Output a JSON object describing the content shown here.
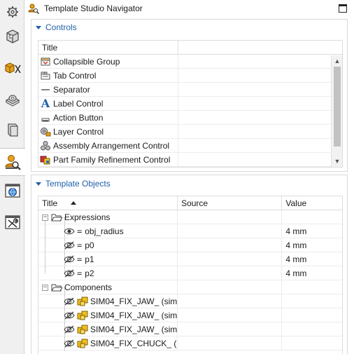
{
  "navigator": {
    "title": "Template Studio Navigator"
  },
  "controls_panel": {
    "header": "Controls",
    "columns": [
      "Title",
      ""
    ],
    "rows": [
      {
        "label": "Collapsible Group",
        "icon": "collapsible-group-icon"
      },
      {
        "label": "Tab Control",
        "icon": "tab-control-icon"
      },
      {
        "label": "Separator",
        "icon": "separator-icon"
      },
      {
        "label": "Label Control",
        "icon": "label-control-icon"
      },
      {
        "label": "Action Button",
        "icon": "action-button-icon"
      },
      {
        "label": "Layer Control",
        "icon": "layer-control-icon"
      },
      {
        "label": "Assembly Arrangement Control",
        "icon": "assembly-arrangement-icon"
      },
      {
        "label": "Part Family Refinement Control",
        "icon": "part-family-icon"
      }
    ],
    "scroll": {
      "up": "▲",
      "down": "▼"
    }
  },
  "objects_panel": {
    "header": "Template Objects",
    "columns": {
      "title": "Title",
      "source": "Source",
      "value": "Value"
    },
    "expressions": {
      "label": "Expressions",
      "expander": "−",
      "items": [
        {
          "name": "obj_radius",
          "value": "4 mm",
          "eq": "=",
          "visible": true
        },
        {
          "name": "p0",
          "value": "4 mm",
          "eq": "=",
          "visible": false
        },
        {
          "name": "p1",
          "value": "4 mm",
          "eq": "=",
          "visible": false
        },
        {
          "name": "p2",
          "value": "4 mm",
          "eq": "=",
          "visible": false
        }
      ]
    },
    "components": {
      "label": "Components",
      "expander": "−",
      "items": [
        {
          "name": "SIM04_FIX_JAW_ (sim..."
        },
        {
          "name": "SIM04_FIX_JAW_ (sim..."
        },
        {
          "name": "SIM04_FIX_JAW_ (sim..."
        },
        {
          "name": "SIM04_FIX_CHUCK_ (..."
        }
      ]
    }
  },
  "colors": {
    "accent": "#1f5fa8",
    "assembly_orange": "#e8a020"
  }
}
